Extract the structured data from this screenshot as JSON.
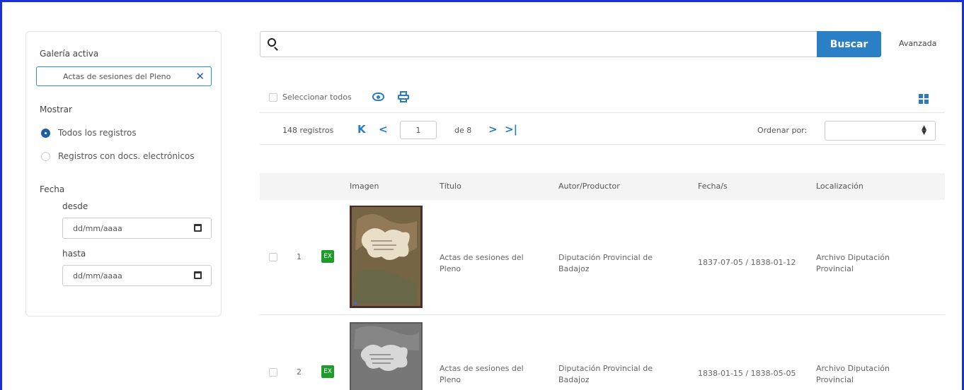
{
  "sidebar": {
    "gallery_label": "Galería activa",
    "gallery_value": "Actas de sesiones del Pleno",
    "gallery_remove": "✕",
    "show_label": "Mostrar",
    "show_options": [
      {
        "label": "Todos los registros",
        "selected": true
      },
      {
        "label": "Registros con docs. electrónicos",
        "selected": false
      }
    ],
    "date_label": "Fecha",
    "from_label": "desde",
    "from_placeholder": "dd/mm/aaaa",
    "to_label": "hasta",
    "to_placeholder": "dd/mm/aaaa"
  },
  "search": {
    "value": "",
    "button_label": "Buscar",
    "advanced_label": "Avanzada"
  },
  "toolbar": {
    "select_all_label": "Seleccionar todos",
    "icons": [
      "eye-icon",
      "print-icon",
      "grid-view-icon"
    ]
  },
  "pagination": {
    "count_label": "148 registros",
    "current_page": "1",
    "of_label": "de 8",
    "first": "K",
    "prev": "<",
    "next": ">",
    "last": ">|",
    "order_label": "Ordenar por:",
    "order_value": ""
  },
  "table": {
    "columns": [
      "Imagen",
      "Título",
      "Autor/Productor",
      "Fecha/s",
      "Localización"
    ],
    "rows": [
      {
        "num": "1",
        "badge": "EX",
        "title": "Actas de sesiones del Pleno",
        "author": "Diputación Provincial de Badajoz",
        "dates": "1837-07-05 / 1838-01-12",
        "location": "Archivo Diputación Provincial"
      },
      {
        "num": "2",
        "badge": "EX",
        "title": "Actas de sesiones del Pleno",
        "author": "Diputación Provincial de Badajoz",
        "dates": "1838-01-15 / 1838-05-05",
        "location": "Archivo Diputación Provincial"
      }
    ]
  },
  "colors": {
    "accent": "#2b7fc4",
    "badge": "#1e9b2a",
    "frame": "#1a2fd6"
  }
}
